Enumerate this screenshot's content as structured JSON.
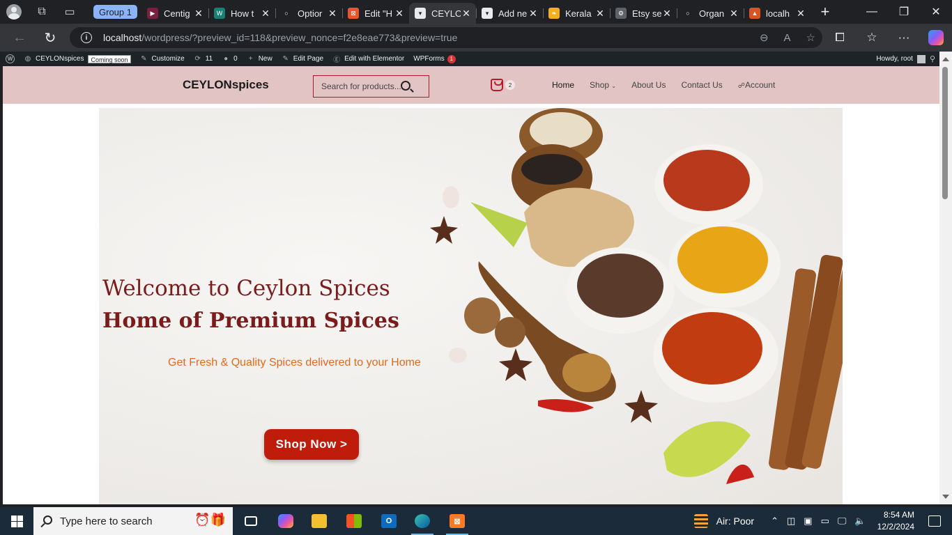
{
  "browser": {
    "group_label": "Group 1",
    "tabs": [
      {
        "label": "Centig",
        "fav_color": "#7a1f3d",
        "glyph": "▶"
      },
      {
        "label": "How t",
        "fav_color": "#1a7f74",
        "glyph": "W"
      },
      {
        "label": "Optior",
        "fav_color": "#202124",
        "glyph": "○"
      },
      {
        "label": "Edit \"H",
        "fav_color": "#e8562a",
        "glyph": "⊠"
      },
      {
        "label": "CEYLO",
        "fav_color": "#e8eaed",
        "glyph": "▾"
      },
      {
        "label": "Add ne",
        "fav_color": "#e8eaed",
        "glyph": "▾"
      },
      {
        "label": "Kerala",
        "fav_color": "#f2b01e",
        "glyph": "❧"
      },
      {
        "label": "Etsy se",
        "fav_color": "#5f6368",
        "glyph": "⚙"
      },
      {
        "label": "Organ",
        "fav_color": "#202124",
        "glyph": "○"
      },
      {
        "label": "localh",
        "fav_color": "#d9541e",
        "glyph": "▲"
      }
    ],
    "new_tab": "+",
    "url_host": "localhost",
    "url_rest": "/wordpress/?preview_id=118&preview_nonce=f2e8eae773&preview=true"
  },
  "adminbar": {
    "site_name": "CEYLONspices",
    "coming_soon": "Coming soon",
    "customize": "Customize",
    "updates": "11",
    "comments": "0",
    "new": "New",
    "edit_page": "Edit Page",
    "edit_elementor": "Edit with Elementor",
    "wpforms": "WPForms",
    "wpforms_count": "1",
    "howdy": "Howdy, root"
  },
  "site": {
    "title": "CEYLONspices",
    "search_placeholder": "Search for products...",
    "cart_count": "2",
    "nav": [
      "Home",
      "Shop",
      "About Us",
      "Contact Us",
      "Account"
    ]
  },
  "hero": {
    "title": "Welcome to Ceylon Spices",
    "subtitle": "Home of Premium Spices",
    "tagline": "Get Fresh & Quality Spices delivered to your Home",
    "cta": "Shop Now >"
  },
  "taskbar": {
    "search_placeholder": "Type here to search",
    "air_quality": "Air: Poor",
    "time": "8:54 AM",
    "date": "12/2/2024"
  }
}
